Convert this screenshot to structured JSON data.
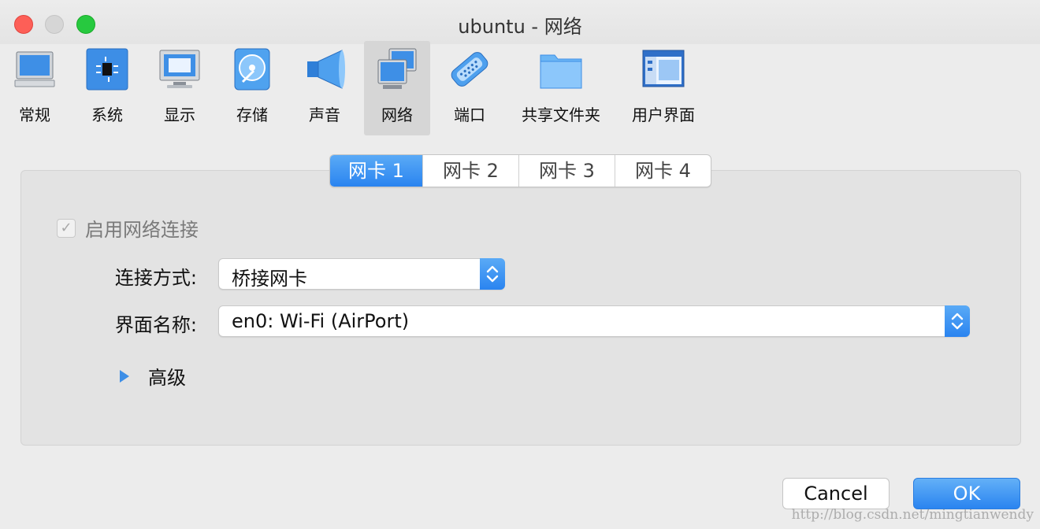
{
  "window": {
    "title": "ubuntu - 网络",
    "buttons": [
      "close",
      "minimize",
      "maximize"
    ]
  },
  "toolbar": {
    "items": [
      {
        "label": "常规",
        "icon": "monitor-general-icon"
      },
      {
        "label": "系统",
        "icon": "chip-icon"
      },
      {
        "label": "显示",
        "icon": "display-icon"
      },
      {
        "label": "存储",
        "icon": "disk-icon"
      },
      {
        "label": "声音",
        "icon": "speaker-icon"
      },
      {
        "label": "网络",
        "icon": "network-icon",
        "active": true
      },
      {
        "label": "端口",
        "icon": "serial-port-icon"
      },
      {
        "label": "共享文件夹",
        "icon": "folder-icon"
      },
      {
        "label": "用户界面",
        "icon": "window-ui-icon"
      }
    ]
  },
  "tabs": {
    "items": [
      {
        "label": "网卡 1",
        "active": true
      },
      {
        "label": "网卡 2"
      },
      {
        "label": "网卡 3"
      },
      {
        "label": "网卡 4"
      }
    ]
  },
  "adapter": {
    "enable_label": "启用网络连接",
    "enabled": true,
    "attach_label": "连接方式:",
    "attach_value": "桥接网卡",
    "name_label": "界面名称:",
    "name_value": "en0: Wi-Fi (AirPort)",
    "advanced_label": "高级"
  },
  "actions": {
    "cancel_label": "Cancel",
    "ok_label": "OK"
  },
  "watermark": "http://blog.csdn.net/mingtianwendy",
  "colors": {
    "accent": "#2a84f0",
    "close": "#fd5f57",
    "maximize": "#27c93f"
  }
}
